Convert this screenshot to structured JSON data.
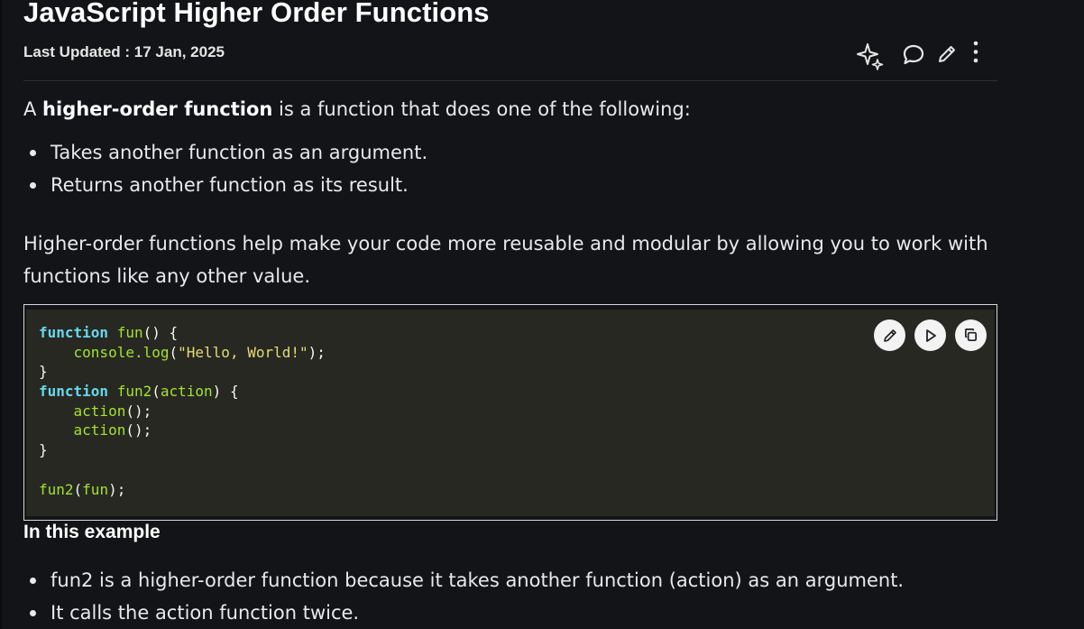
{
  "article": {
    "title": "JavaScript Higher Order Functions",
    "last_updated": "Last Updated : 17 Jan, 2025",
    "actions": [
      "ai-sparkle-icon",
      "comment-icon",
      "edit-icon",
      "more-icon"
    ],
    "intro_prefix": "A ",
    "intro_bold": "higher-order function",
    "intro_suffix": " is a function that does one of the following:",
    "intro_bullets": [
      "Takes another function as an argument.",
      "Returns another function as its result."
    ],
    "paragraph": "Higher-order functions help make your code more reusable and modular by allowing you to work with functions like any other value.",
    "code_buttons": [
      "edit-icon",
      "run-icon",
      "copy-icon"
    ],
    "code": {
      "kw_function": "function",
      "fun_name": "fun",
      "fun_params": "() {",
      "console_log": "console.log",
      "hello_string": "\"Hello, World!\"",
      "close_paren_semi": ");",
      "close_brace": "}",
      "fun2_name": "fun2",
      "action_param": "action",
      "open_brace": ") {",
      "action_call": "action",
      "call_parens": "();",
      "call_fun2": "fun2",
      "call_arg": "fun",
      "open_paren": "(",
      "indent": "    "
    },
    "example_heading": "In this example",
    "example_bullets": [
      "fun2 is a higher-order function because it takes another function (action) as an argument.",
      "It calls the action function twice."
    ],
    "colors": {
      "background": "#131417",
      "code_background": "#272822",
      "keyword": "#66d9ef",
      "function_name": "#a6e22e",
      "string": "#e6db74"
    }
  }
}
